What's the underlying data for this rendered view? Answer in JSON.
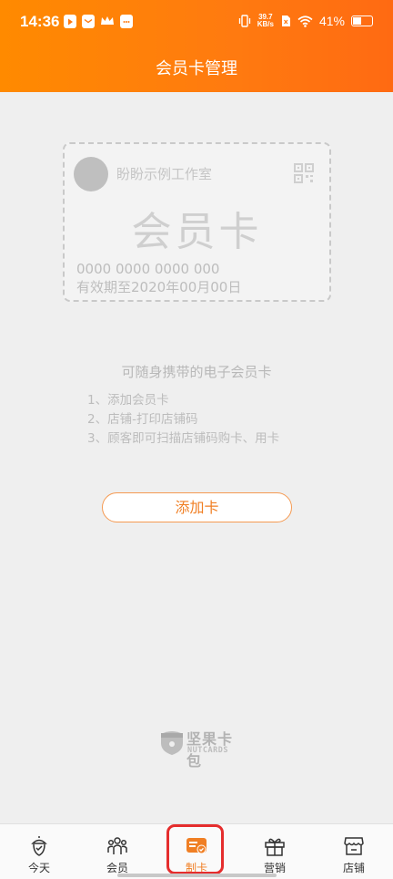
{
  "status_bar": {
    "time": "14:36",
    "net_speed_value": "39.7",
    "net_speed_unit": "KB/s",
    "battery": "41%",
    "battery_level": 0.41
  },
  "header": {
    "title": "会员卡管理"
  },
  "card": {
    "shop_name": "盼盼示例工作室",
    "title": "会员卡",
    "number": "0000 0000 0000 000",
    "expiry": "有效期至2020年00月00日"
  },
  "intro": {
    "title": "可随身携带的电子会员卡",
    "steps": [
      "1、添加会员卡",
      "2、店铺-打印店铺码",
      "3、顾客即可扫描店铺码购卡、用卡"
    ]
  },
  "actions": {
    "add_card_label": "添加卡"
  },
  "brand": {
    "name_cn": "坚果卡包",
    "name_en": "NUTCARDS"
  },
  "tabbar": {
    "tabs": [
      {
        "label": "今天",
        "icon": "acorn-icon"
      },
      {
        "label": "会员",
        "icon": "members-icon"
      },
      {
        "label": "制卡",
        "icon": "card-make-icon",
        "active": true
      },
      {
        "label": "营销",
        "icon": "gift-icon"
      },
      {
        "label": "店铺",
        "icon": "store-icon"
      }
    ]
  },
  "colors": {
    "accent": "#f07f24",
    "header_start": "#ff8a00",
    "header_end": "#ff6a12",
    "highlight": "#e52d2d"
  }
}
